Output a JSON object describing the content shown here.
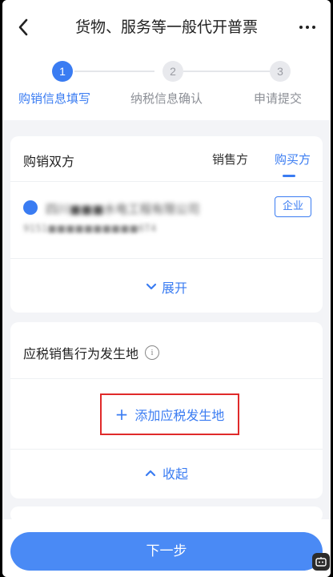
{
  "nav": {
    "title": "货物、服务等一般代开普票"
  },
  "steps": [
    {
      "number": "1",
      "label": "购销信息填写"
    },
    {
      "number": "2",
      "label": "纳税信息确认"
    },
    {
      "number": "3",
      "label": "申请提交"
    }
  ],
  "parties": {
    "heading": "购销双方",
    "tab_seller": "销售方",
    "tab_buyer": "购买方",
    "name": "四川■■■水电工程有限公司",
    "id": "9151■■■■■■■■■■6T4",
    "badge": "企业",
    "expand_label": "展开"
  },
  "location": {
    "heading": "应税销售行为发生地",
    "add_label": "添加应税发生地",
    "collapse_label": "收起"
  },
  "footer": {
    "next_label": "下一步"
  },
  "colors": {
    "accent": "#3a7cf2",
    "button": "#4a8af5",
    "highlight_border": "#e02a2a"
  }
}
